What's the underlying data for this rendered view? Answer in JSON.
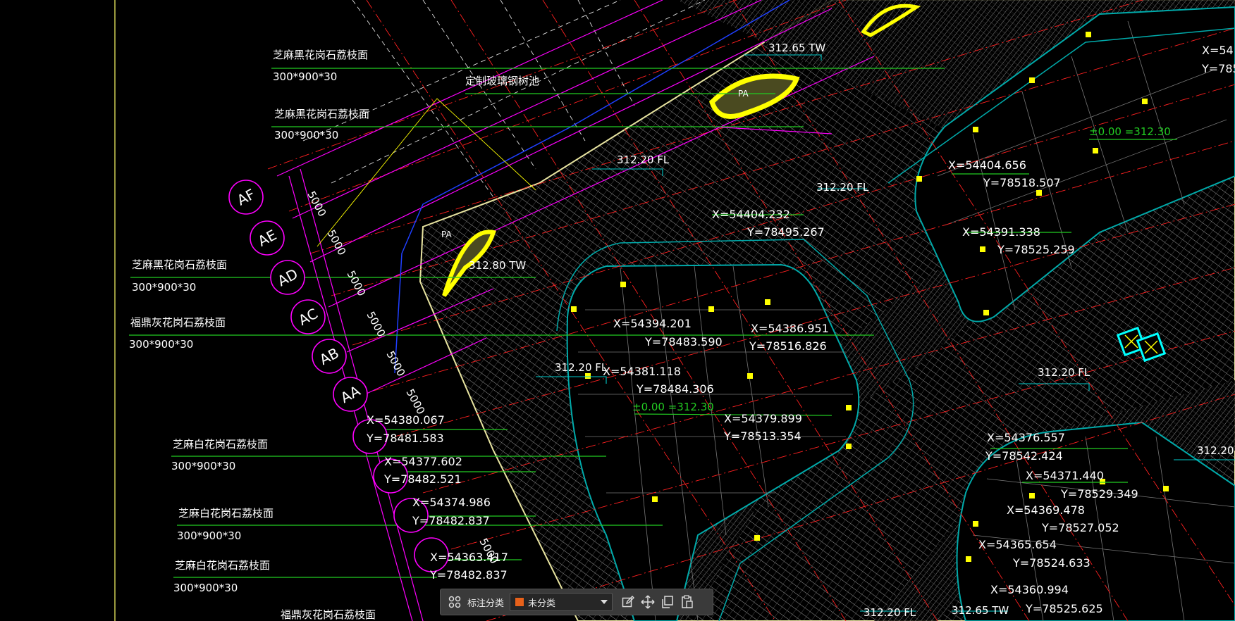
{
  "drawing": {
    "material_labels": [
      {
        "name": "芝麻黑花岗石荔枝面",
        "size": "300*900*30"
      },
      {
        "name": "定制玻璃钢树池",
        "size": ""
      },
      {
        "name": "芝麻黑花岗石荔枝面",
        "size": "300*900*30"
      },
      {
        "name": "芝麻黑花岗石荔枝面",
        "size": "300*900*30"
      },
      {
        "name": "福鼎灰花岗石荔枝面",
        "size": "300*900*30"
      },
      {
        "name": "芝麻白花岗石荔枝面",
        "size": "300*900*30"
      },
      {
        "name": "芝麻白花岗石荔枝面",
        "size": "300*900*30"
      },
      {
        "name": "芝麻白花岗石荔枝面",
        "size": "300*900*30"
      },
      {
        "name": "福鼎灰花岗石荔枝面",
        "size": ""
      }
    ],
    "grid_bubbles": [
      "AF",
      "AE",
      "AD",
      "AC",
      "AB",
      "AA"
    ],
    "dimensions": [
      "5000",
      "5000",
      "5000",
      "5000",
      "5000",
      "5000",
      "5000"
    ],
    "elevations": [
      "312.65 TW",
      "312.20 FL",
      "312.20 FL",
      "312.80 TW",
      "312.20 FL",
      "312.20 FL",
      "312.20 FL",
      "312.20",
      "312.65 TW",
      "±0.00 =312.30",
      "±0.00 =312.30"
    ],
    "coordinates": [
      {
        "x": "X=54404.656",
        "y": "Y=78518.507"
      },
      {
        "x": "X=54404.232",
        "y": "Y=78495.267"
      },
      {
        "x": "X=54391.338",
        "y": "Y=78525.259"
      },
      {
        "x": "X=54394.201",
        "y": "Y=78483.590"
      },
      {
        "x": "X=54386.951",
        "y": "Y=78516.826"
      },
      {
        "x": "X=54381.118",
        "y": "Y=78484.306"
      },
      {
        "x": "X=54379.899",
        "y": "Y=78513.354"
      },
      {
        "x": "X=54380.067",
        "y": "Y=78481.583"
      },
      {
        "x": "X=54377.602",
        "y": "Y=78482.521"
      },
      {
        "x": "X=54374.986",
        "y": "Y=78482.837"
      },
      {
        "x": "X=54363.417",
        "y": "Y=78482.837"
      },
      {
        "x": "X=54376.557",
        "y": "Y=78542.424"
      },
      {
        "x": "X=54371.440",
        "y": "Y=78529.349"
      },
      {
        "x": "X=54369.478",
        "y": "Y=78527.052"
      },
      {
        "x": "X=54365.654",
        "y": "Y=78524.633"
      },
      {
        "x": "X=54360.994",
        "y": "Y=78525.625"
      },
      {
        "x": "X=54",
        "y": "Y=785"
      }
    ],
    "small_marks": [
      "PA",
      "PA"
    ],
    "colors": {
      "background": "#000000",
      "green": "#22cc22",
      "magenta": "#ff00ff",
      "red": "#ff2020",
      "cyan": "#00cccc",
      "yellow": "#ffff00",
      "blue": "#1f3fff",
      "white": "#ffffff",
      "paving": "#bdbdbd"
    }
  },
  "toolbar": {
    "grid_icon": "grid-icon",
    "label": "标注分类",
    "category_value": "未分类",
    "category_color": "#e8611a",
    "edit_icon": "edit-icon",
    "move_icon": "move-icon",
    "copy_icon": "copy-icon",
    "paste_icon": "paste-icon"
  }
}
